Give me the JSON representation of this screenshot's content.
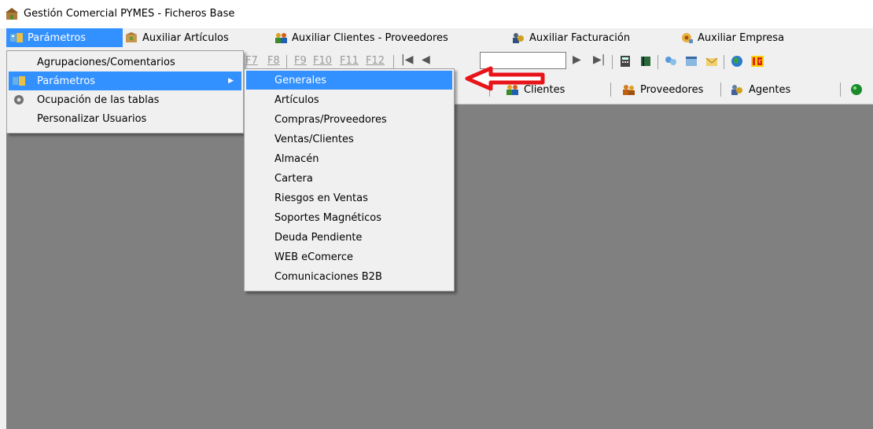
{
  "window": {
    "title": "Gestión Comercial PYMES  -  Ficheros Base",
    "app_icon": "app-icon"
  },
  "menubar": {
    "items": [
      {
        "label": "Parámetros",
        "icon": "parametros-icon",
        "active": true
      },
      {
        "label": "Auxiliar Artículos",
        "icon": "articulos-icon"
      },
      {
        "label": "Auxiliar Clientes - Proveedores",
        "icon": "clientes-icon"
      },
      {
        "label": "Auxiliar Facturación",
        "icon": "facturacion-icon"
      },
      {
        "label": "Auxiliar Empresa",
        "icon": "empresa-icon"
      }
    ]
  },
  "toolbar": {
    "fkeys": [
      "F7",
      "F8",
      "F9",
      "F10",
      "F11",
      "F12"
    ],
    "nav_value": "",
    "buttons": [
      {
        "label": "Clientes",
        "accel": "C",
        "icon": "clientes-icon"
      },
      {
        "label": "Proveedores",
        "accel": "P",
        "icon": "proveedores-icon"
      },
      {
        "label": "Agentes",
        "accel": "",
        "icon": "agentes-icon"
      }
    ]
  },
  "menu_parametros": {
    "items": [
      {
        "label": "Agrupaciones/Comentarios"
      },
      {
        "label": "Parámetros",
        "icon": "parametros-icon",
        "has_submenu": true,
        "active": true
      },
      {
        "label": "Ocupación de las tablas",
        "icon": "gear-icon"
      },
      {
        "label": "Personalizar Usuarios"
      }
    ]
  },
  "submenu_parametros": {
    "items": [
      "Generales",
      "Artículos",
      "Compras/Proveedores",
      "Ventas/Clientes",
      "Almacén",
      "Cartera",
      "Riesgos en Ventas",
      "Soportes Magnéticos",
      "Deuda Pendiente",
      "WEB  eComerce",
      "Comunicaciones B2B"
    ],
    "active_index": 0
  },
  "colors": {
    "highlight": "#3390ff",
    "workspace": "#808080",
    "arrow": "#e8141a"
  }
}
